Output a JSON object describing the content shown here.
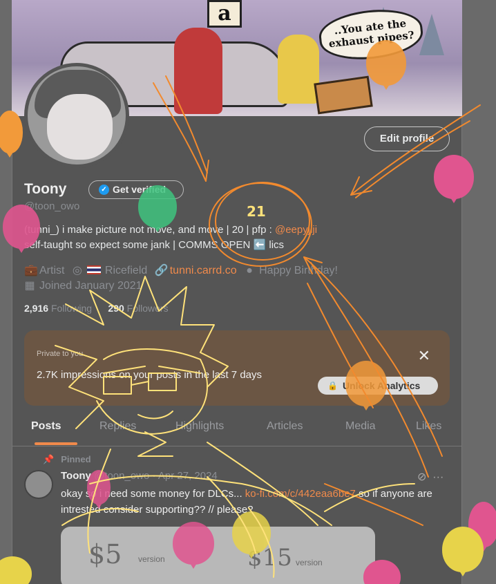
{
  "banner": {
    "sign_letter": "a",
    "speech_bubble": "..You ate the exhaust pipes?"
  },
  "profile": {
    "edit_button": "Edit profile",
    "name": "Toony",
    "get_verified": "Get verified",
    "handle": "@toon_owo",
    "bio_line1_pre": "(tunni_) i make picture not move, and move | 20 | pfp : ",
    "bio_line1_link": "@eepyjiji",
    "bio_line2": "self-taught so expect some jank | COMMS OPEN ",
    "bio_line2_emoji": "⬅️",
    "bio_line2_post": " lics",
    "profession": "Artist",
    "location": "Ricefield",
    "website": "tunni.carrd.co",
    "birthday": "Happy Birthday!",
    "joined": "Joined January 2021",
    "following_count": "2,916",
    "following_label": "Following",
    "followers_count": "290",
    "followers_label": "Followers"
  },
  "analytics": {
    "private_label": "Private to you",
    "impressions_text": "2.7K impressions on your posts in the last 7 days",
    "unlock_button": "Unlock Analytics",
    "close": "✕"
  },
  "tabs": [
    "Posts",
    "Replies",
    "Highlights",
    "Articles",
    "Media",
    "Likes"
  ],
  "post": {
    "pinned_label": "Pinned",
    "author_name": "Toony",
    "author_handle": "@toon_owo",
    "date": "· Apr 27, 2024",
    "text_pre": "okay so i need some money for DLCs... ",
    "text_link": "ko-fi.com/c/442eaa6be7",
    "text_post": " so if anyone are intrested consider supporting?? // please?",
    "card_left": "$5",
    "card_left_small": "version",
    "card_right": "$15",
    "card_right_small": "version",
    "more_icon": "···"
  },
  "annotation": {
    "scribble_number": "21"
  },
  "colors": {
    "accent": "#f08a4b",
    "verified_blue": "#1d9bf0",
    "doodle_yellow": "#ffe27a",
    "doodle_orange": "#f28a2e",
    "balloon_pink": "#e0558f",
    "balloon_orange": "#f29a3a",
    "balloon_green": "#3fc47f",
    "balloon_yellow": "#e7d34a"
  }
}
